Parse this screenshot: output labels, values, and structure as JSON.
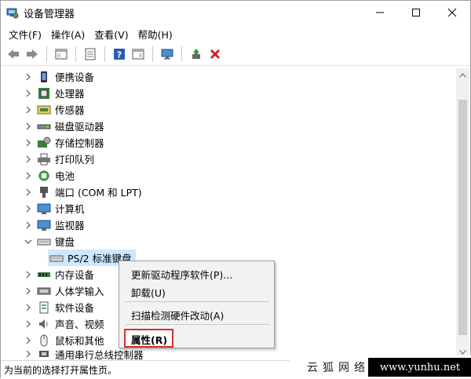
{
  "window": {
    "title": "设备管理器"
  },
  "menu": [
    "文件(F)",
    "操作(A)",
    "查看(V)",
    "帮助(H)"
  ],
  "toolbar": {
    "buttons": [
      "back-icon",
      "forward-icon",
      "show-hide-tree-icon",
      "properties-icon",
      "help-icon",
      "view-icon",
      "monitor-icon",
      "update-driver-icon",
      "uninstall-icon"
    ]
  },
  "tree": {
    "rows": [
      {
        "label": "便携设备",
        "icon": "portable-device-icon"
      },
      {
        "label": "处理器",
        "icon": "processor-icon"
      },
      {
        "label": "传感器",
        "icon": "sensor-icon"
      },
      {
        "label": "磁盘驱动器",
        "icon": "disk-drive-icon"
      },
      {
        "label": "存储控制器",
        "icon": "storage-controller-icon"
      },
      {
        "label": "打印队列",
        "icon": "printer-icon"
      },
      {
        "label": "电池",
        "icon": "battery-icon"
      },
      {
        "label": "端口 (COM 和 LPT)",
        "icon": "port-icon"
      },
      {
        "label": "计算机",
        "icon": "computer-icon"
      },
      {
        "label": "监视器",
        "icon": "monitor-icon"
      },
      {
        "label": "键盘",
        "icon": "keyboard-icon",
        "expanded": true
      },
      {
        "label": "PS/2 标准键盘",
        "icon": "keyboard-icon",
        "child": true
      },
      {
        "label": "内存设备",
        "icon": "memory-icon"
      },
      {
        "label": "人体学输入",
        "icon": "hid-icon"
      },
      {
        "label": "软件设备",
        "icon": "software-device-icon"
      },
      {
        "label": "声音、视频",
        "icon": "audio-icon"
      },
      {
        "label": "鼠标和其他",
        "icon": "mouse-icon"
      },
      {
        "label": "通用串行总线控制器",
        "icon": "usb-icon"
      }
    ]
  },
  "context_menu": {
    "items": [
      "更新驱动程序软件(P)...",
      "卸载(U)",
      "扫描检测硬件改动(A)",
      "属性(R)"
    ],
    "highlight_color": "#d9302c"
  },
  "status": {
    "text": "为当前的选择打开属性页。"
  },
  "watermark": {
    "cn": "云狐网络",
    "url": "www.yunhu.net"
  },
  "colors": {
    "accent_red": "#d9302c",
    "selection_blue": "#cce8ff"
  }
}
